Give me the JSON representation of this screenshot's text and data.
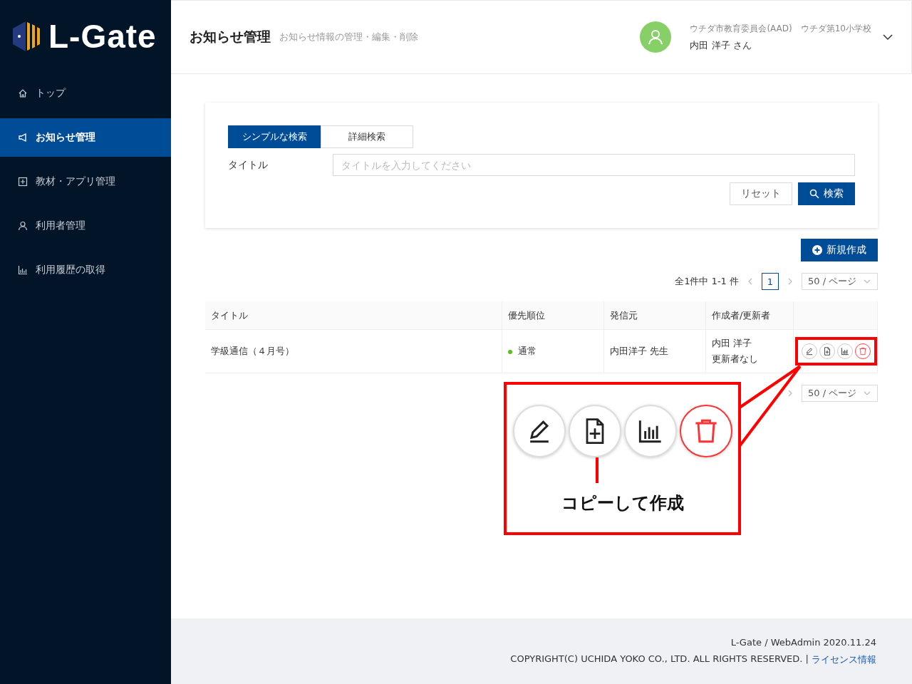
{
  "sidebar": {
    "logo": "L-Gate",
    "items": [
      {
        "label": "トップ",
        "selected": false
      },
      {
        "label": "お知らせ管理",
        "selected": true
      },
      {
        "label": "教材・アプリ管理",
        "selected": false
      },
      {
        "label": "利用者管理",
        "selected": false
      },
      {
        "label": "利用履歴の取得",
        "selected": false
      }
    ]
  },
  "header": {
    "title": "お知らせ管理",
    "subtitle": "お知らせ情報の管理・編集・削除",
    "organization": "ウチダ市教育委員会(AAD)　ウチダ第10小学校",
    "user": "内田 洋子 さん"
  },
  "search": {
    "tabs": [
      {
        "label": "シンプルな検索",
        "selected": true
      },
      {
        "label": "詳細検索",
        "selected": false
      }
    ],
    "field_label": "タイトル",
    "placeholder": "タイトルを入力してください",
    "reset_button": "リセット",
    "search_button": "検索"
  },
  "new_button": "新規作成",
  "pagination": {
    "summary": "全1件中 1-1 件",
    "page": "1",
    "page_size": "50 / ページ"
  },
  "table": {
    "columns": [
      "タイトル",
      "優先順位",
      "発信元",
      "作成者/更新者"
    ],
    "rows": [
      {
        "title": "学級通信（４月号）",
        "priority": "通常",
        "color": "#52c41a",
        "sender": "内田洋子 先生",
        "author": "内田 洋子",
        "updater": "更新者なし"
      }
    ]
  },
  "pagination_bottom": {
    "page_size": "50 / ページ"
  },
  "callout": {
    "caption": "コピーして作成"
  },
  "footer": {
    "version": "L-Gate / WebAdmin 2020.11.24",
    "copyright": "COPYRIGHT(C) UCHIDA YOKO CO., LTD. ALL RIGHTS RESERVED. |",
    "license_link": "ライセンス情報"
  }
}
